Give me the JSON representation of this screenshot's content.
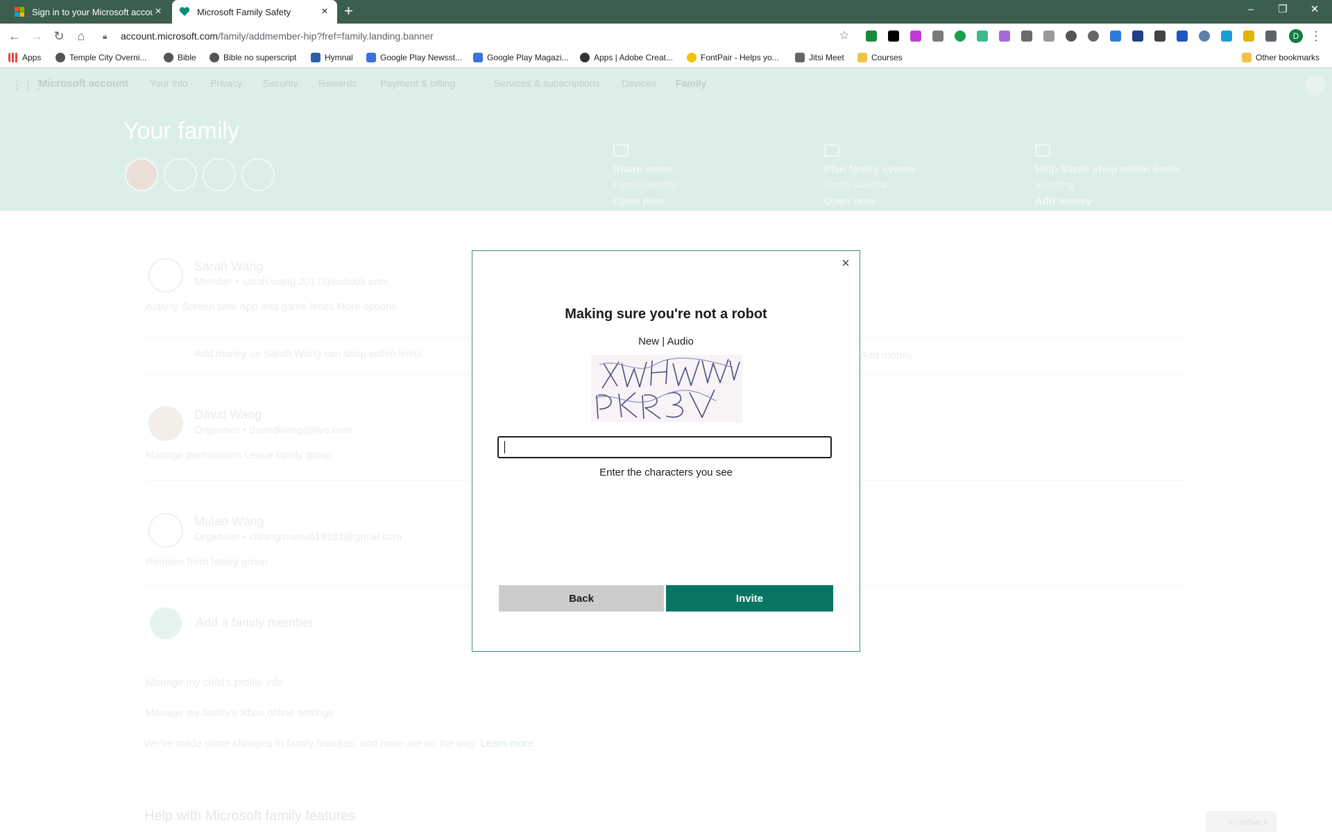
{
  "browser": {
    "tabs": [
      {
        "title": "Sign in to your Microsoft account",
        "active": false
      },
      {
        "title": "Microsoft Family Safety",
        "active": true
      }
    ],
    "new_tab": "+",
    "url_host": "account.microsoft.com",
    "url_path": "/family/addmember-hip?fref=family.landing.banner",
    "profile_initial": "D",
    "bookmarks": [
      "Apps",
      "Temple City Overni...",
      "Bible",
      "Bible no superscript",
      "Hymnal",
      "Google Play Newsst...",
      "Google Play Magazi...",
      "Apps | Adobe Creat...",
      "FontPair - Helps yo...",
      "Jitsi Meet",
      "Courses"
    ],
    "other_bookmarks": "Other bookmarks"
  },
  "ms_header": {
    "brand": "Microsoft account",
    "nav": [
      "Your info",
      "Privacy",
      "Security",
      "Rewards",
      "Payment & billing",
      "Services & subscriptions",
      "Devices",
      "Family"
    ]
  },
  "hero": {
    "title": "Your family",
    "promos": [
      {
        "title": "Share notes",
        "sub": "Family OneNote",
        "link": "Open now"
      },
      {
        "title": "Plan family events",
        "sub": "Family calendar",
        "link": "Open now"
      },
      {
        "title": "Help Sarah shop within limits",
        "sub": "Spending",
        "link": "Add money"
      }
    ]
  },
  "members": [
    {
      "name": "Sarah Wang",
      "role": "Member",
      "email": "sarah.wang.2017@outlook.com",
      "actions": "Activity    Screen time    App and game limits    More options"
    },
    {
      "name": "David Wang",
      "role": "Organiser",
      "email": "duendwang@live.com",
      "actions": "Manage permissions    Leave family group"
    },
    {
      "name": "Mulan Wang",
      "role": "Organiser",
      "email": "chiangmumu618181@gmail.com",
      "actions": "Remove from family group"
    }
  ],
  "background_text": {
    "add_money_row": "Add money so Sarah Wang can shop within limits",
    "add_money_link": "Add money",
    "add_member": "Add a family member",
    "child_profile": "Manage my child's profile info",
    "xbox": "Manage my family's Xbox online settings",
    "changes": "We've made some changes to family features, and more are on the way.",
    "learn_more": "Learn more",
    "help_heading": "Help with Microsoft family features",
    "feedback": "Feedback"
  },
  "dialog": {
    "title": "Making sure you're not a robot",
    "option_new": "New",
    "option_separator": "|",
    "option_audio": "Audio",
    "input_value": "",
    "hint": "Enter the characters you see",
    "back_label": "Back",
    "invite_label": "Invite",
    "close_icon": "close-icon"
  },
  "colors": {
    "accent": "#087563",
    "dialog_border": "#2f8f83",
    "hero_bg": "#dceee8",
    "tab_strip": "#3b5e4f"
  }
}
